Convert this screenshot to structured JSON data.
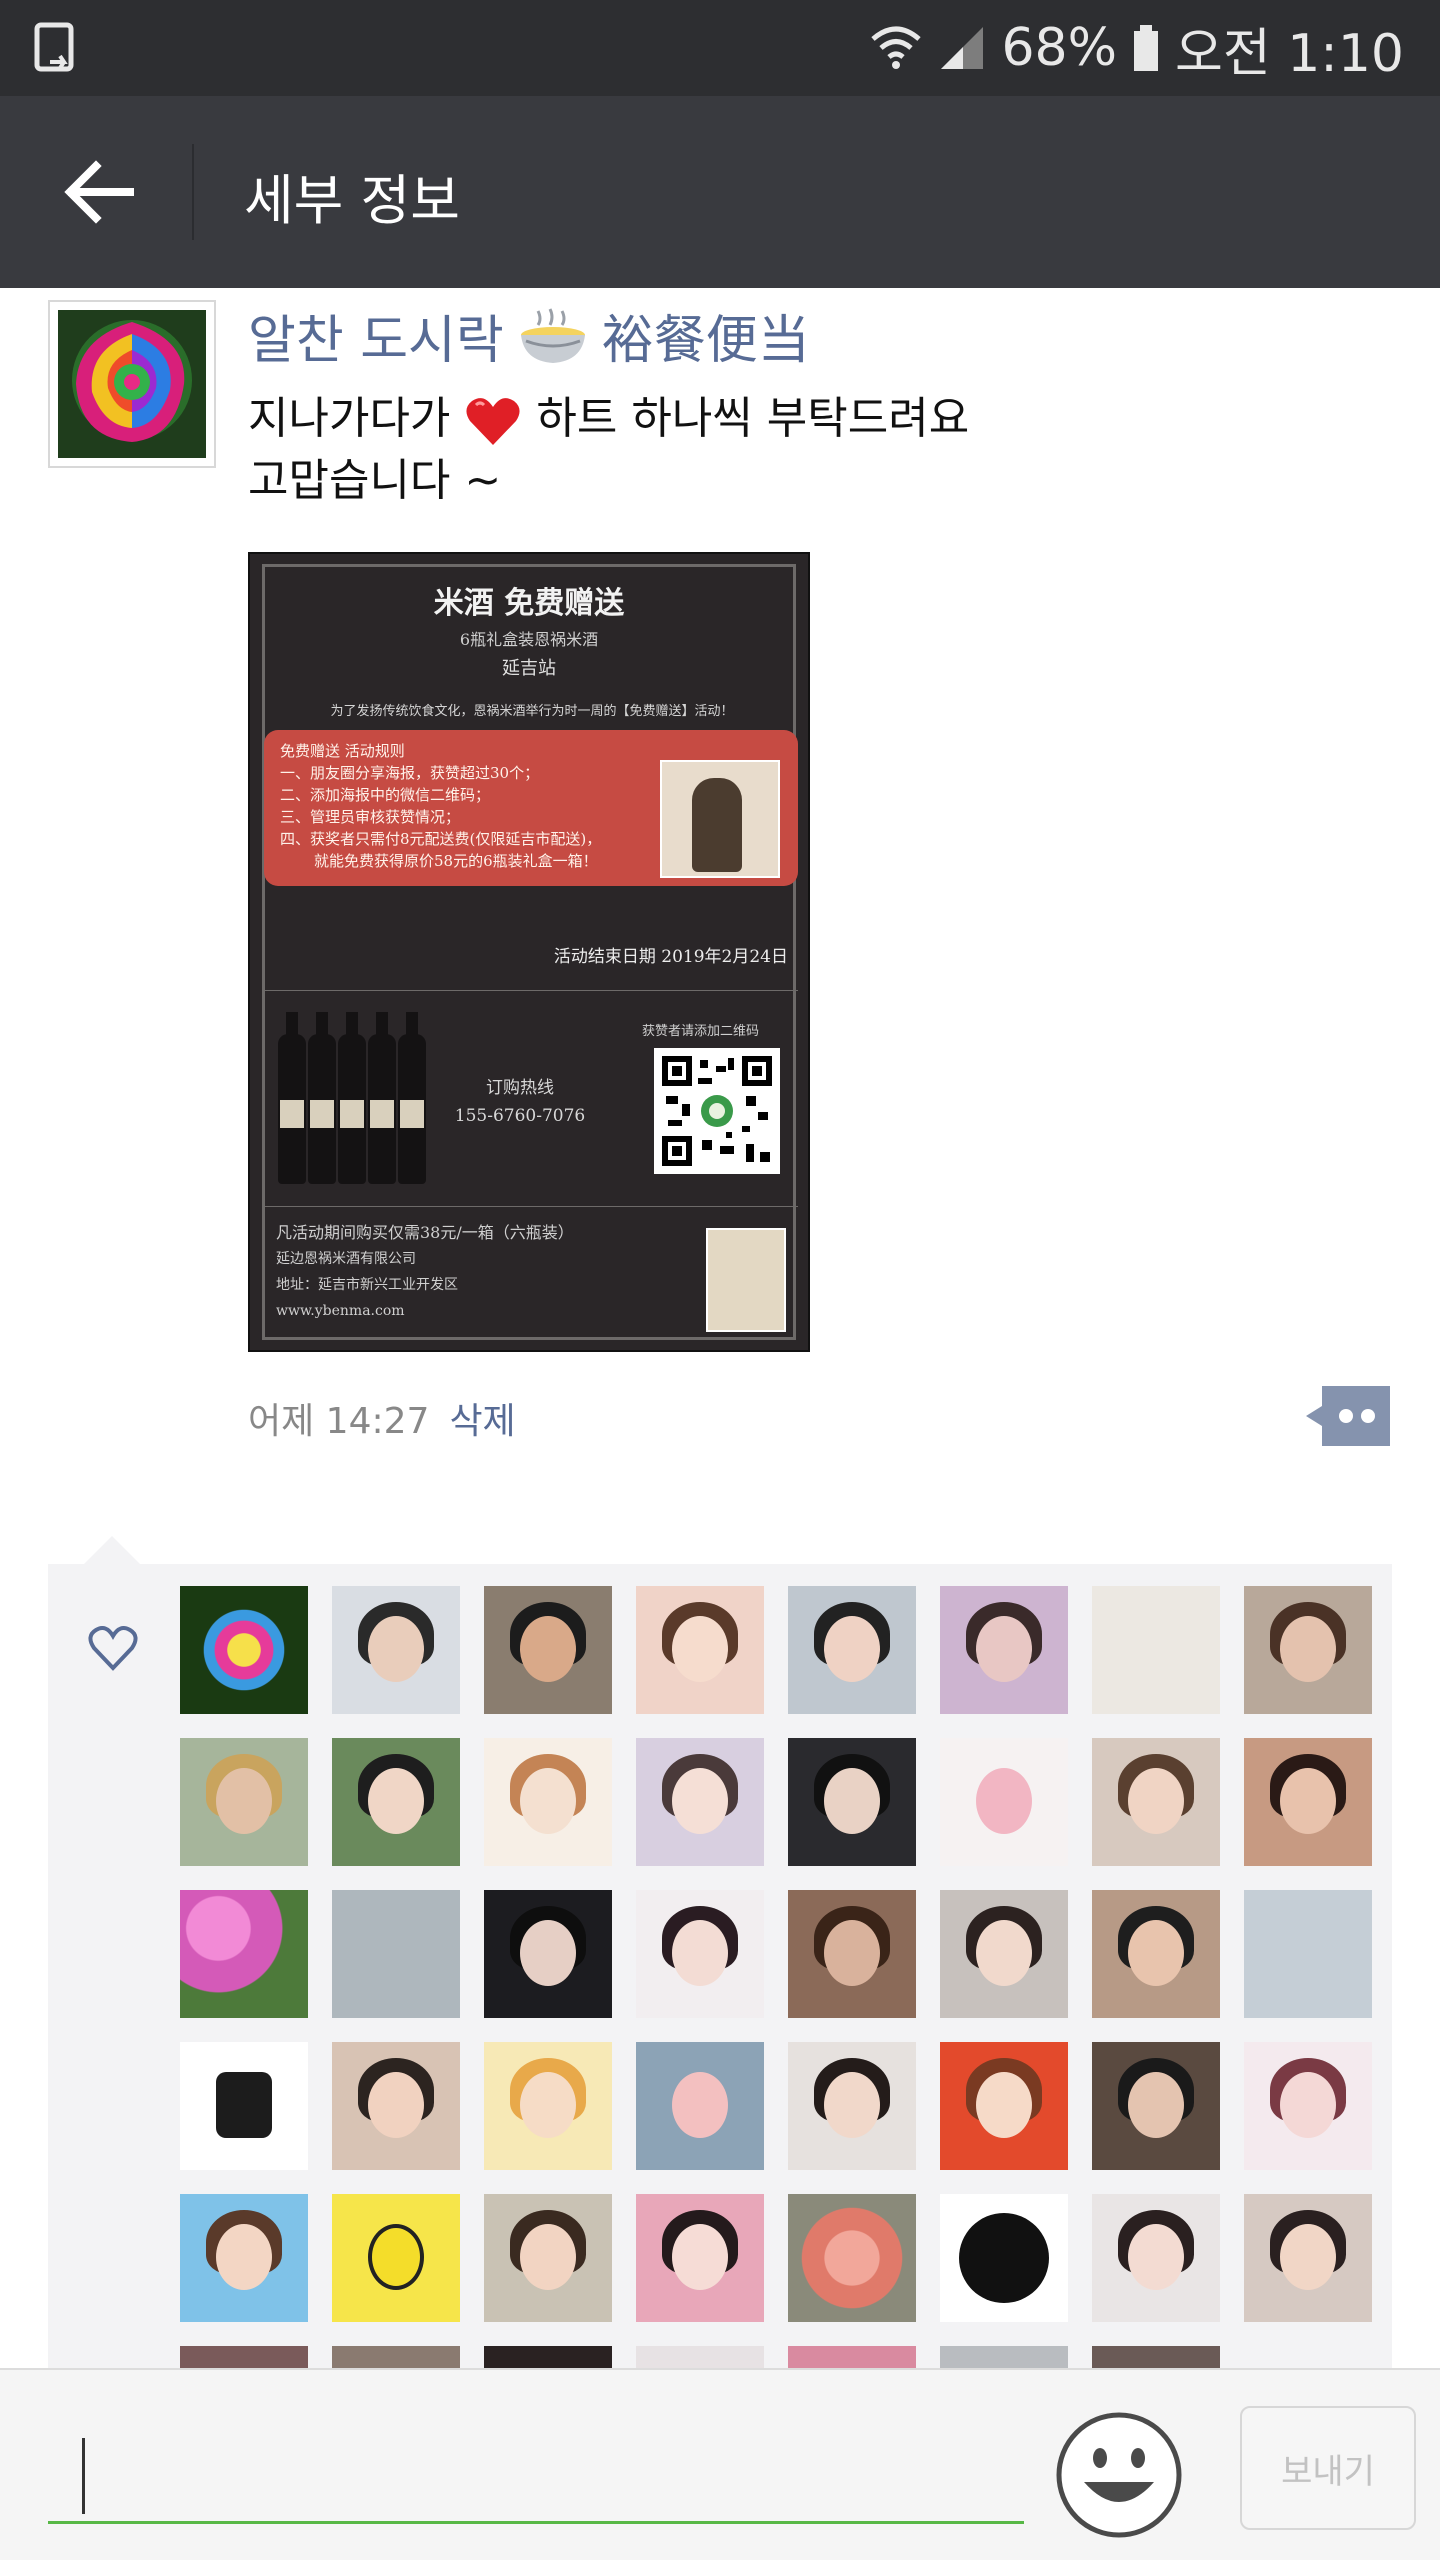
{
  "status_bar": {
    "battery_text": "68%",
    "time_text": "오전 1:10"
  },
  "header": {
    "title": "세부 정보"
  },
  "post": {
    "username_ko": "알찬 도시락",
    "username_cn": "裕餐便当",
    "text_line1_a": "지나가다가",
    "text_line1_b": "하트 하나씩 부탁드려요",
    "text_line2": "고맙습니다 ~",
    "time": "어제 14:27",
    "delete_label": "삭제"
  },
  "poster": {
    "title": "米酒 免费赠送",
    "subtitle": "6瓶礼盒装恩祸米酒",
    "city": "延吉站",
    "intro": "为了发扬传统饮食文化，恩祸米酒举行为时一周的【免费赠送】活动！",
    "rules": [
      "免费赠送 活动规则",
      "一、朋友圈分享海报，获赞超过30个；",
      "二、添加海报中的微信二维码；",
      "三、管理员审核获赞情况；",
      "四、获奖者只需付8元配送费(仅限延吉市配送)，",
      "就能免费获得原价58元的6瓶装礼盒一箱！"
    ],
    "end_date": "活动结束日期 2019年2月24日",
    "hotline_label": "订购热线",
    "hotline_number": "155-6760-7076",
    "qr_caption": "获赞者请添加二维码",
    "footer_line1": "凡活动期间购买仅需38元/一箱（六瓶装）",
    "footer_line2": "延边恩祸米酒有限公司",
    "footer_line3": "地址：延吉市新兴工业开发区",
    "footer_line4": "www.ybenma.com"
  },
  "input_bar": {
    "send_label": "보내기"
  },
  "colors": {
    "status_bar": "#2d2e31",
    "header": "#393a3f",
    "link": "#576b95",
    "input_underline": "#57b846",
    "likes_bg": "#f3f3f5"
  },
  "icons": {
    "back": "arrow-left-icon",
    "comment": "comment-dots-icon",
    "like": "heart-outline-icon",
    "emoji": "smiley-face-icon"
  }
}
